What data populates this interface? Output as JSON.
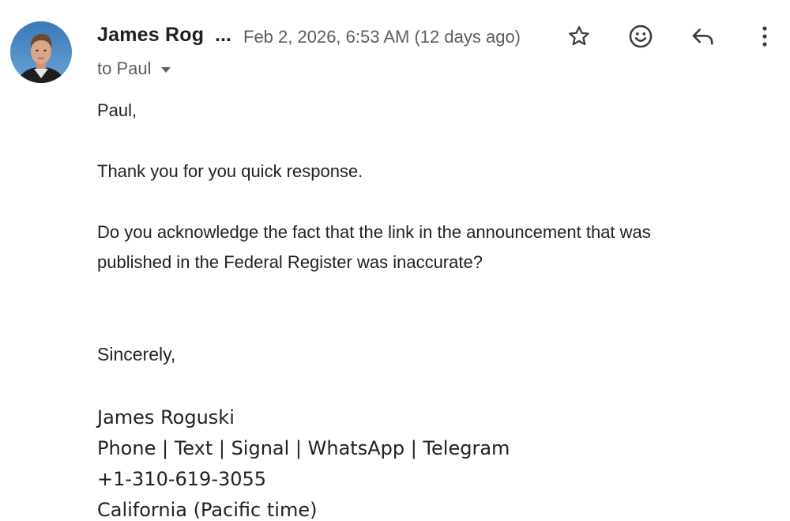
{
  "message": {
    "sender_name": "James Rog",
    "sender_ellipsis": "...",
    "date": "Feb 2, 2026, 6:53 AM (12 days ago)",
    "recipient": "to Paul",
    "greeting": "Paul,",
    "line1": "Thank you for you quick response.",
    "line2": "Do you acknowledge the fact that the link in the announcement that was",
    "line3": "published in the Federal Register was inaccurate?",
    "closing": "Sincerely,",
    "signature": {
      "name": "James Roguski",
      "contact_methods": "Phone | Text | Signal | WhatsApp | Telegram",
      "phone": "+1-310-619-3055",
      "location": "California (Pacific time)"
    }
  },
  "actions": {
    "star_icon": "star-icon",
    "emoji_icon": "emoji-icon",
    "reply_icon": "reply-icon",
    "more_icon": "more-vert-icon"
  }
}
